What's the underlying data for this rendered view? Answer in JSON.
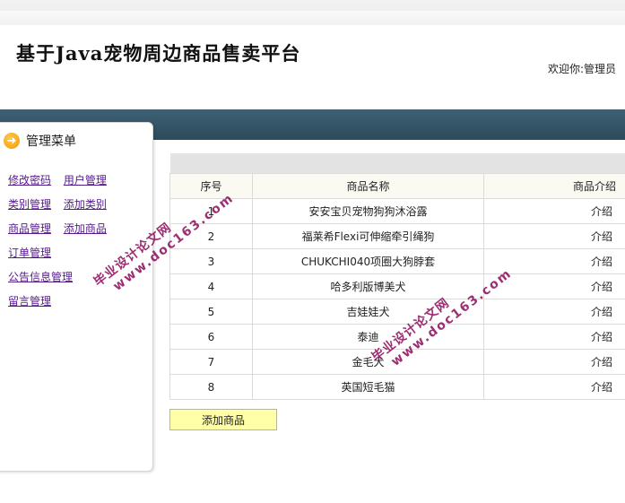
{
  "header": {
    "title": "基于Java宠物周边商品售卖平台",
    "welcome": "欢迎你:管理员"
  },
  "sidebar": {
    "title": "管理菜单",
    "items": [
      [
        "修改密码",
        "用户管理"
      ],
      [
        "类别管理",
        "添加类别"
      ],
      [
        "商品管理",
        "添加商品"
      ],
      [
        "订单管理"
      ],
      [
        "公告信息管理"
      ],
      [
        "留言管理"
      ]
    ]
  },
  "table": {
    "headers": [
      "序号",
      "商品名称",
      "商品介绍"
    ],
    "rows": [
      [
        "1",
        "安安宝贝宠物狗狗沐浴露",
        "介绍"
      ],
      [
        "2",
        "福莱希Flexi可伸缩牵引绳狗",
        "介绍"
      ],
      [
        "3",
        "CHUKCHI040项圈大狗脖套",
        "介绍"
      ],
      [
        "4",
        "哈多利版博美犬",
        "介绍"
      ],
      [
        "5",
        "吉娃娃犬",
        "介绍"
      ],
      [
        "6",
        "泰迪",
        "介绍"
      ],
      [
        "7",
        "金毛犬",
        "介绍"
      ],
      [
        "8",
        "英国短毛猫",
        "介绍"
      ]
    ]
  },
  "actions": {
    "add_product": "添加商品"
  },
  "watermark": {
    "text": "毕业设计论文网",
    "url": "www.doc163.com"
  },
  "colors": {
    "navbar": "#345668",
    "link": "#551a8b",
    "button_bg": "#ffffa8",
    "watermark": "#8b0a5a"
  }
}
